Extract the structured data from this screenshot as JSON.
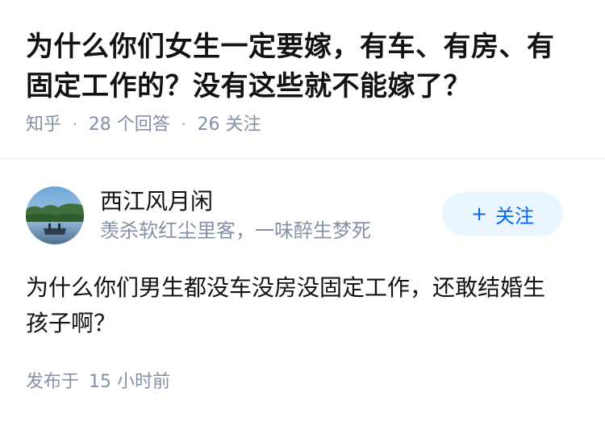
{
  "question": {
    "title": "为什么你们女生一定要嫁，有车、有房、有固定工作的？没有这些就不能嫁了？",
    "source": "知乎",
    "answers_count": "28 个回答",
    "followers_count": "26 关注"
  },
  "answer": {
    "author_name": "西江风月闲",
    "author_bio": "羡杀软红尘里客，一味醉生梦死",
    "follow_label": "关注",
    "follow_icon": "plus-icon",
    "content": "为什么你们男生都没车没房没固定工作，还敢结婚生孩子啊？",
    "time_prefix": "发布于",
    "time_value": "15 小时前"
  },
  "colors": {
    "accent": "#0066ff",
    "follow_bg": "#ebf5fd",
    "meta_gray": "#8590a6"
  }
}
